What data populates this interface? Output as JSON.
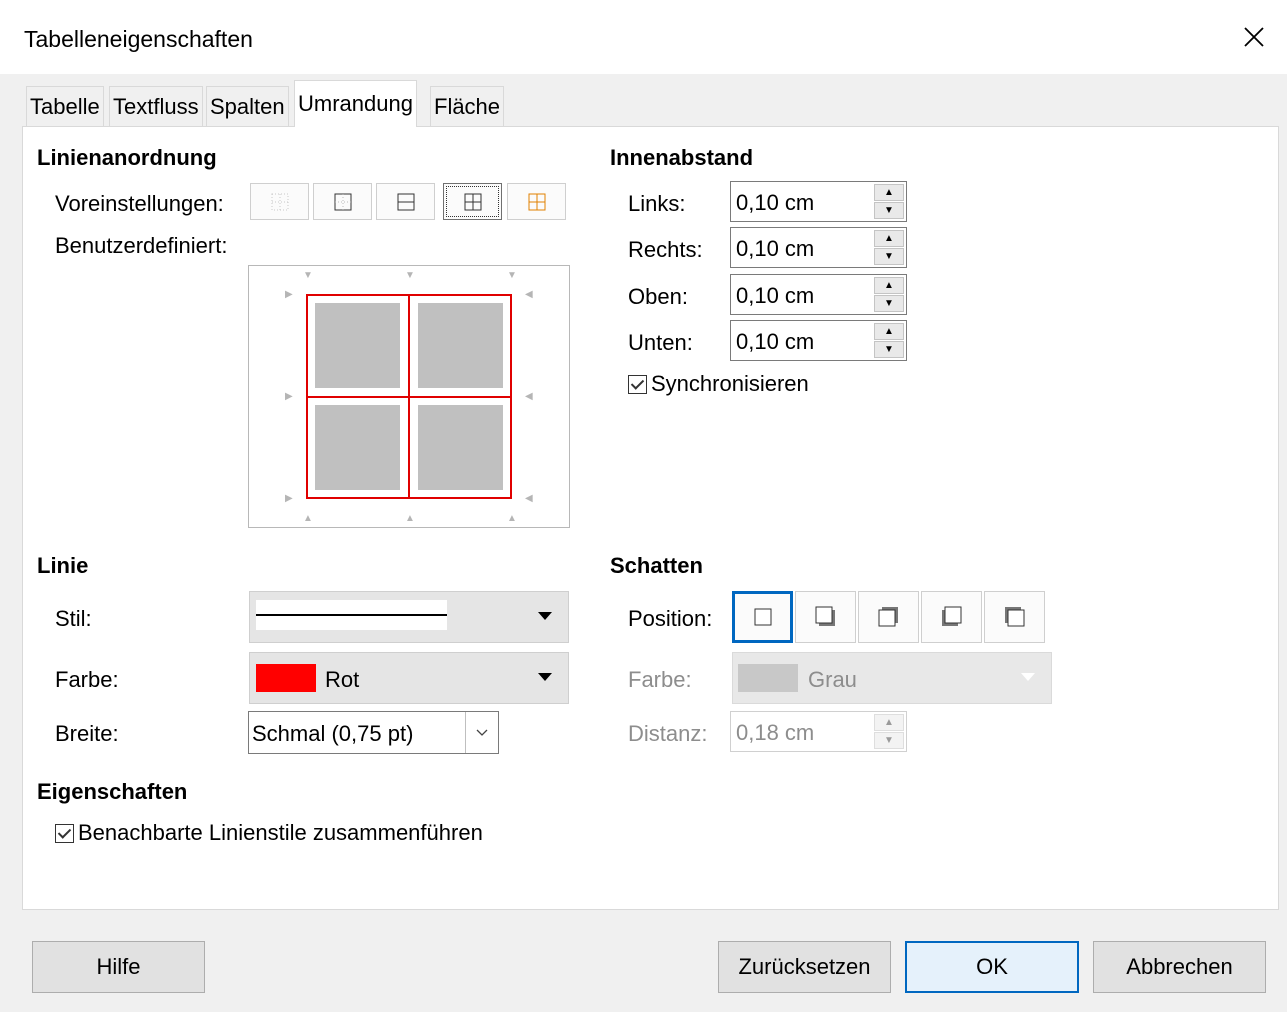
{
  "window": {
    "title": "Tabelleneigenschaften"
  },
  "tabs": [
    {
      "label": "Tabelle"
    },
    {
      "label": "Textfluss"
    },
    {
      "label": "Spalten"
    },
    {
      "label": "Umrandung",
      "active": true
    },
    {
      "label": "Fläche"
    }
  ],
  "line_arrangement": {
    "heading": "Linienanordnung",
    "presets_label": "Voreinstellungen:",
    "custom_label": "Benutzerdefiniert:",
    "presets": [
      "none",
      "outer",
      "outer-horizontal",
      "outer-all-inner",
      "outer-keep-inner"
    ],
    "selected_preset": 3
  },
  "padding": {
    "heading": "Innenabstand",
    "left": {
      "label": "Links:",
      "value": "0,10 cm"
    },
    "right": {
      "label": "Rechts:",
      "value": "0,10 cm"
    },
    "top": {
      "label": "Oben:",
      "value": "0,10 cm"
    },
    "bottom": {
      "label": "Unten:",
      "value": "0,10 cm"
    },
    "sync": {
      "label": "Synchronisieren",
      "checked": true
    }
  },
  "line": {
    "heading": "Linie",
    "style_label": "Stil:",
    "color_label": "Farbe:",
    "color_value": "Rot",
    "color_swatch": "#ff0000",
    "width_label": "Breite:",
    "width_value": "Schmal (0,75 pt)"
  },
  "shadow": {
    "heading": "Schatten",
    "position_label": "Position:",
    "positions": [
      "no-shadow",
      "bottom-right",
      "top-right",
      "bottom-left",
      "top-left"
    ],
    "selected_position": 0,
    "color_label": "Farbe:",
    "color_value": "Grau",
    "color_swatch": "#c0c0c0",
    "distance_label": "Distanz:",
    "distance_value": "0,18 cm"
  },
  "properties": {
    "heading": "Eigenschaften",
    "merge_label": "Benachbarte Linienstile zusammenführen",
    "merge_checked": true
  },
  "buttons": {
    "help": "Hilfe",
    "reset": "Zurücksetzen",
    "ok": "OK",
    "cancel": "Abbrechen"
  },
  "colors": {
    "accent": "#0067c0",
    "border_line": "#e00000"
  }
}
